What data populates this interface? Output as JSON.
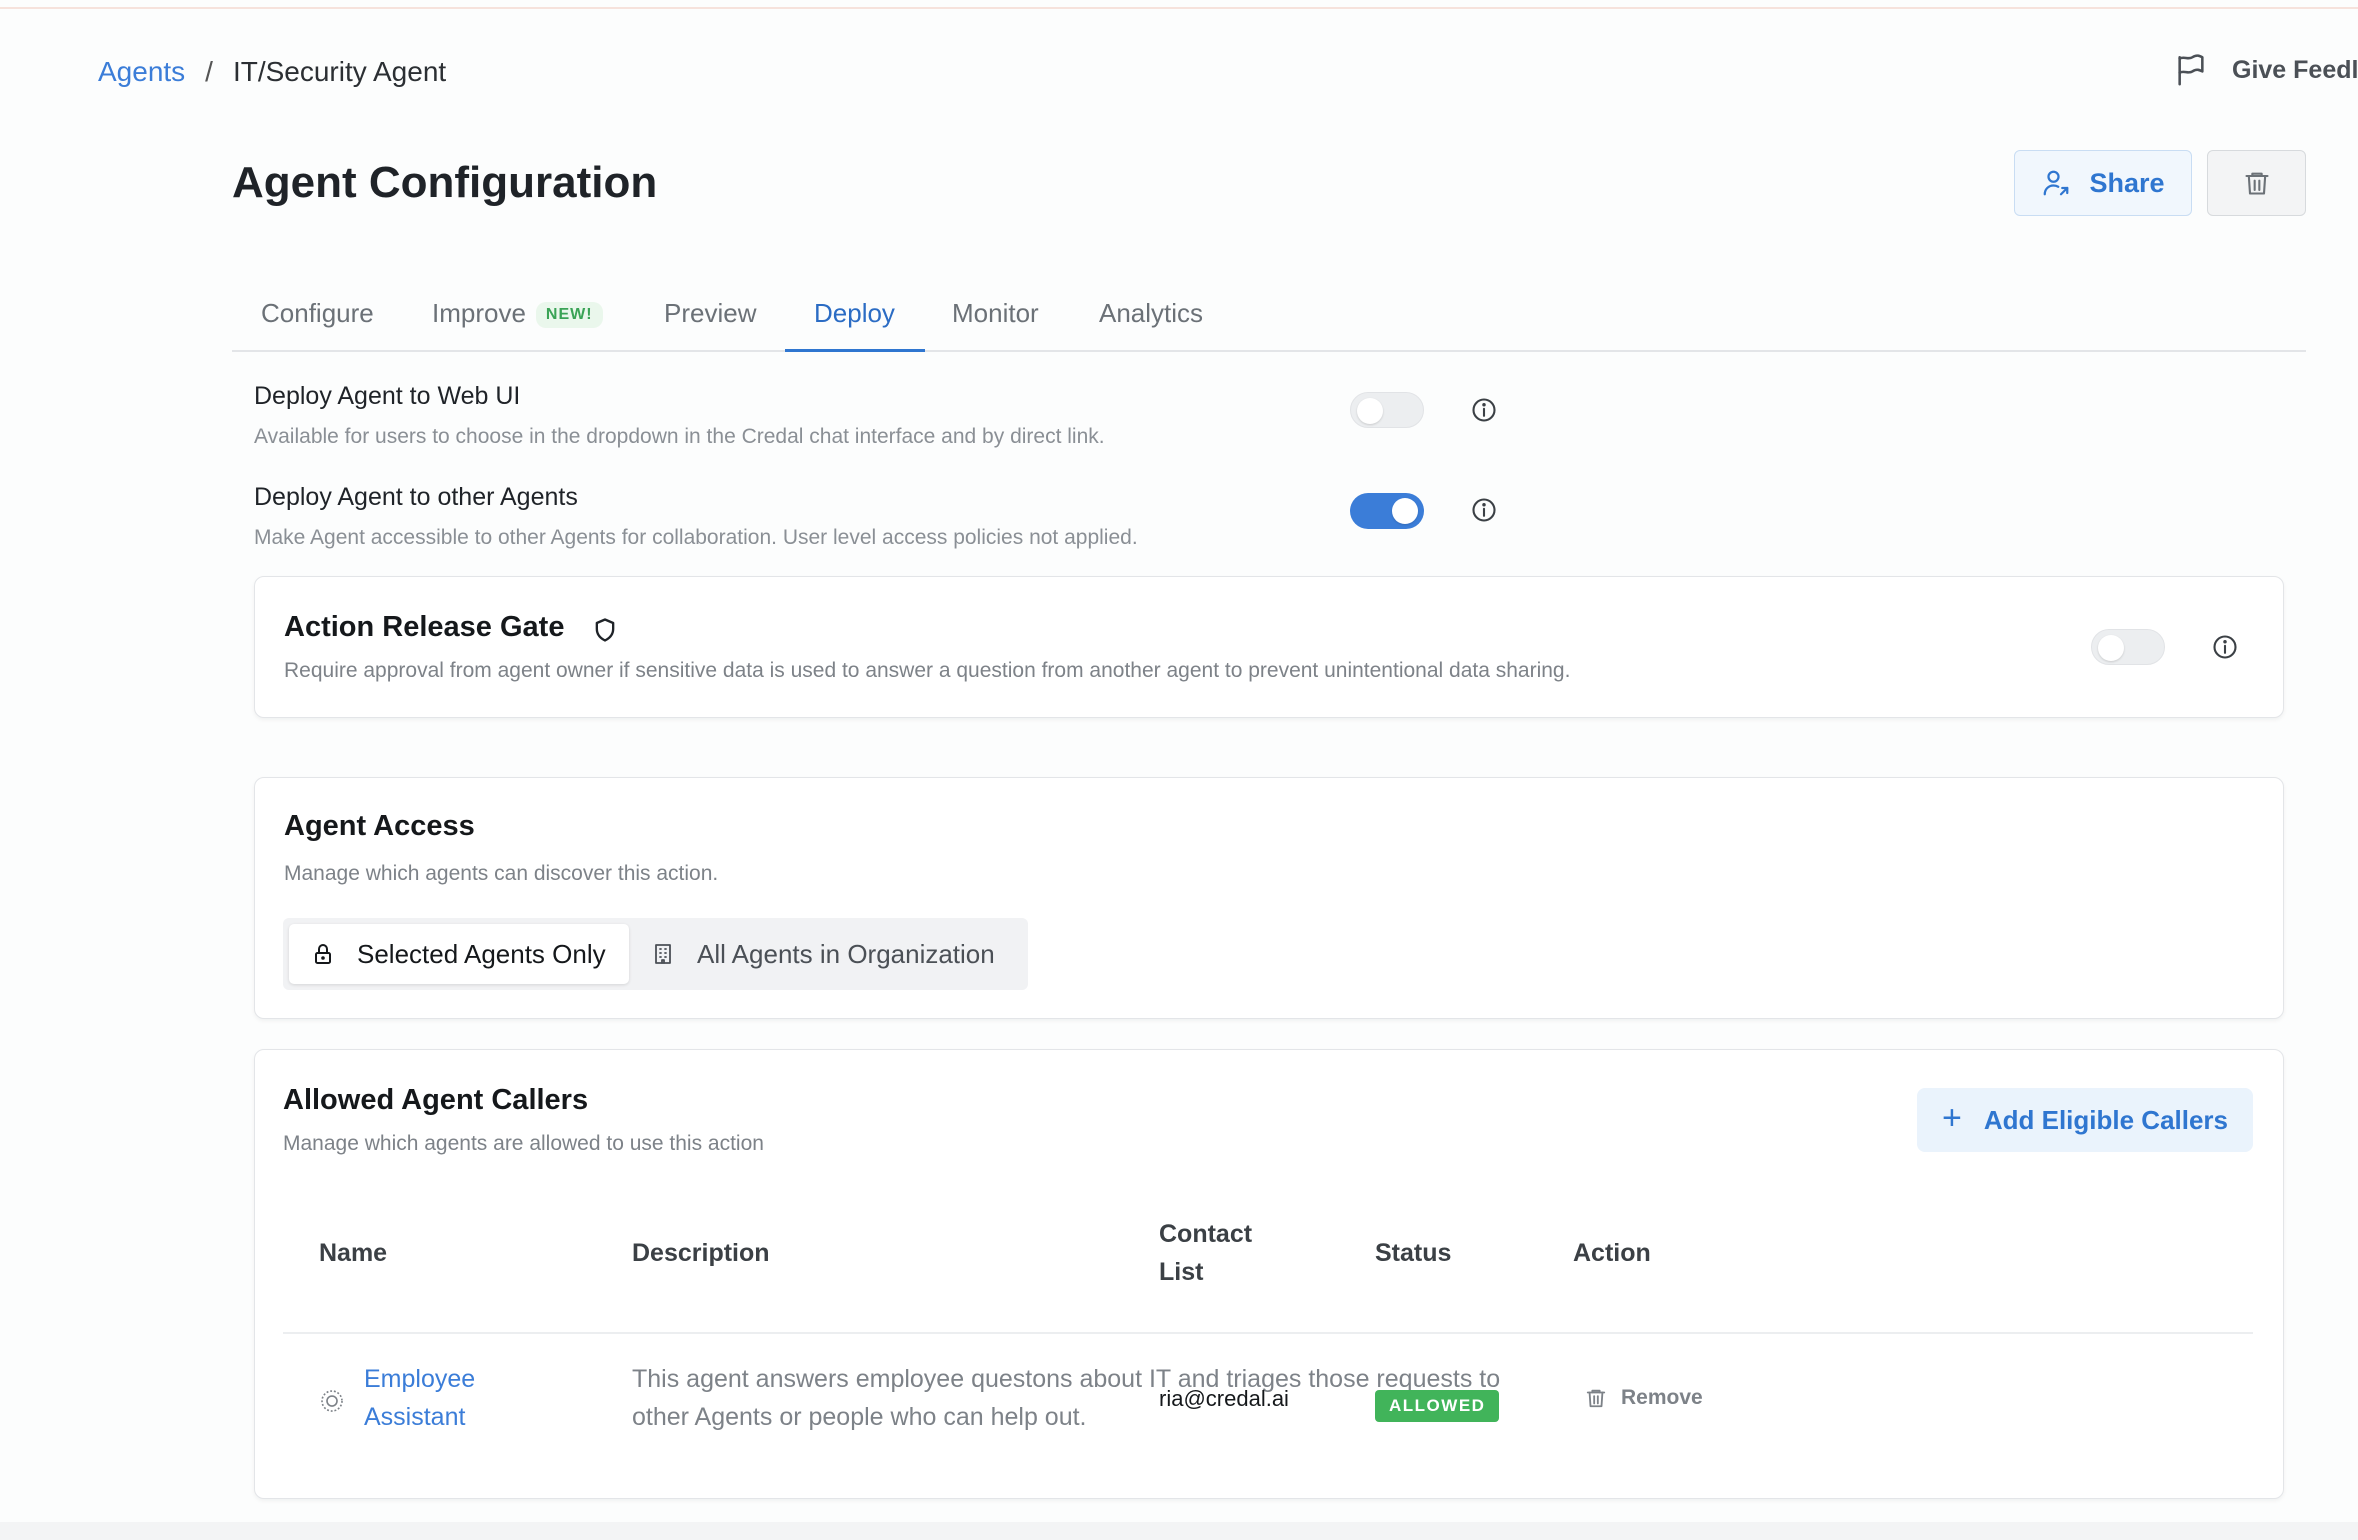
{
  "breadcrumb": {
    "root": "Agents",
    "separator": "/",
    "current": "IT/Security Agent"
  },
  "header": {
    "feedback_label": "Give Feedl",
    "title": "Agent Configuration",
    "share_label": "Share"
  },
  "tabs": [
    {
      "label": "Configure"
    },
    {
      "label": "Improve",
      "badge": "NEW!"
    },
    {
      "label": "Preview"
    },
    {
      "label": "Deploy",
      "active": true
    },
    {
      "label": "Monitor"
    },
    {
      "label": "Analytics"
    }
  ],
  "deploy": {
    "web_ui": {
      "title": "Deploy Agent to Web UI",
      "desc": "Available for users to choose in the dropdown in the Credal chat interface and by direct link.",
      "enabled": false
    },
    "other_agents": {
      "title": "Deploy Agent to other Agents",
      "desc": "Make Agent accessible to other Agents for collaboration. User level access policies not applied.",
      "enabled": true
    }
  },
  "release_gate": {
    "title": "Action Release Gate",
    "desc": "Require approval from agent owner if sensitive data is used to answer a question from another agent to prevent unintentional data sharing.",
    "enabled": false
  },
  "agent_access": {
    "title": "Agent Access",
    "desc": "Manage which agents can discover this action.",
    "options": [
      "Selected Agents Only",
      "All Agents in Organization"
    ],
    "selected": "Selected Agents Only"
  },
  "callers": {
    "title": "Allowed Agent Callers",
    "desc": "Manage which agents are allowed to use this action",
    "add_label": "Add Eligible Callers",
    "columns": {
      "name": "Name",
      "description": "Description",
      "contact_line1": "Contact",
      "contact_line2": "List",
      "status": "Status",
      "action": "Action"
    },
    "rows": [
      {
        "name_line1": "Employee",
        "name_line2": "Assistant",
        "desc_line1": "This agent answers employee questons about IT and triages those requests to",
        "desc_line2": "other Agents or people who can help out.",
        "contact": "ria@credal.ai",
        "status": "ALLOWED",
        "action": "Remove"
      }
    ]
  },
  "colors": {
    "accent": "#2f76d0",
    "status_allowed": "#41b45a",
    "badge_new": "#3aa356"
  }
}
